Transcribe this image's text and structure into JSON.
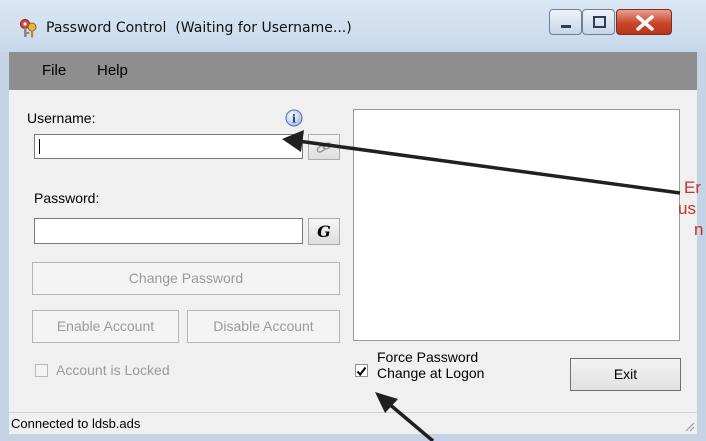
{
  "window": {
    "title": "Password Control  (Waiting for Username...)"
  },
  "menu": {
    "file": "File",
    "help": "Help"
  },
  "form": {
    "username_label": "Username:",
    "username_value": "",
    "password_label": "Password:",
    "password_value": "",
    "generate_label": "G",
    "change_password_label": "Change Password",
    "enable_account_label": "Enable Account",
    "disable_account_label": "Disable Account",
    "account_locked_label": "Account is Locked",
    "account_locked_checked": false,
    "force_change_label_line1": "Force Password",
    "force_change_label_line2": "Change at Logon",
    "force_change_checked": true,
    "exit_label": "Exit"
  },
  "status": {
    "text": "Connected to ldsb.ads"
  },
  "annotation": {
    "line1": "Er",
    "line2": "us",
    "line3": "n",
    "color": "#c0332a"
  },
  "icons": {
    "app": "keys-icon",
    "info": "info-icon",
    "lookup": "link-icon",
    "generate": "generate-icon"
  }
}
